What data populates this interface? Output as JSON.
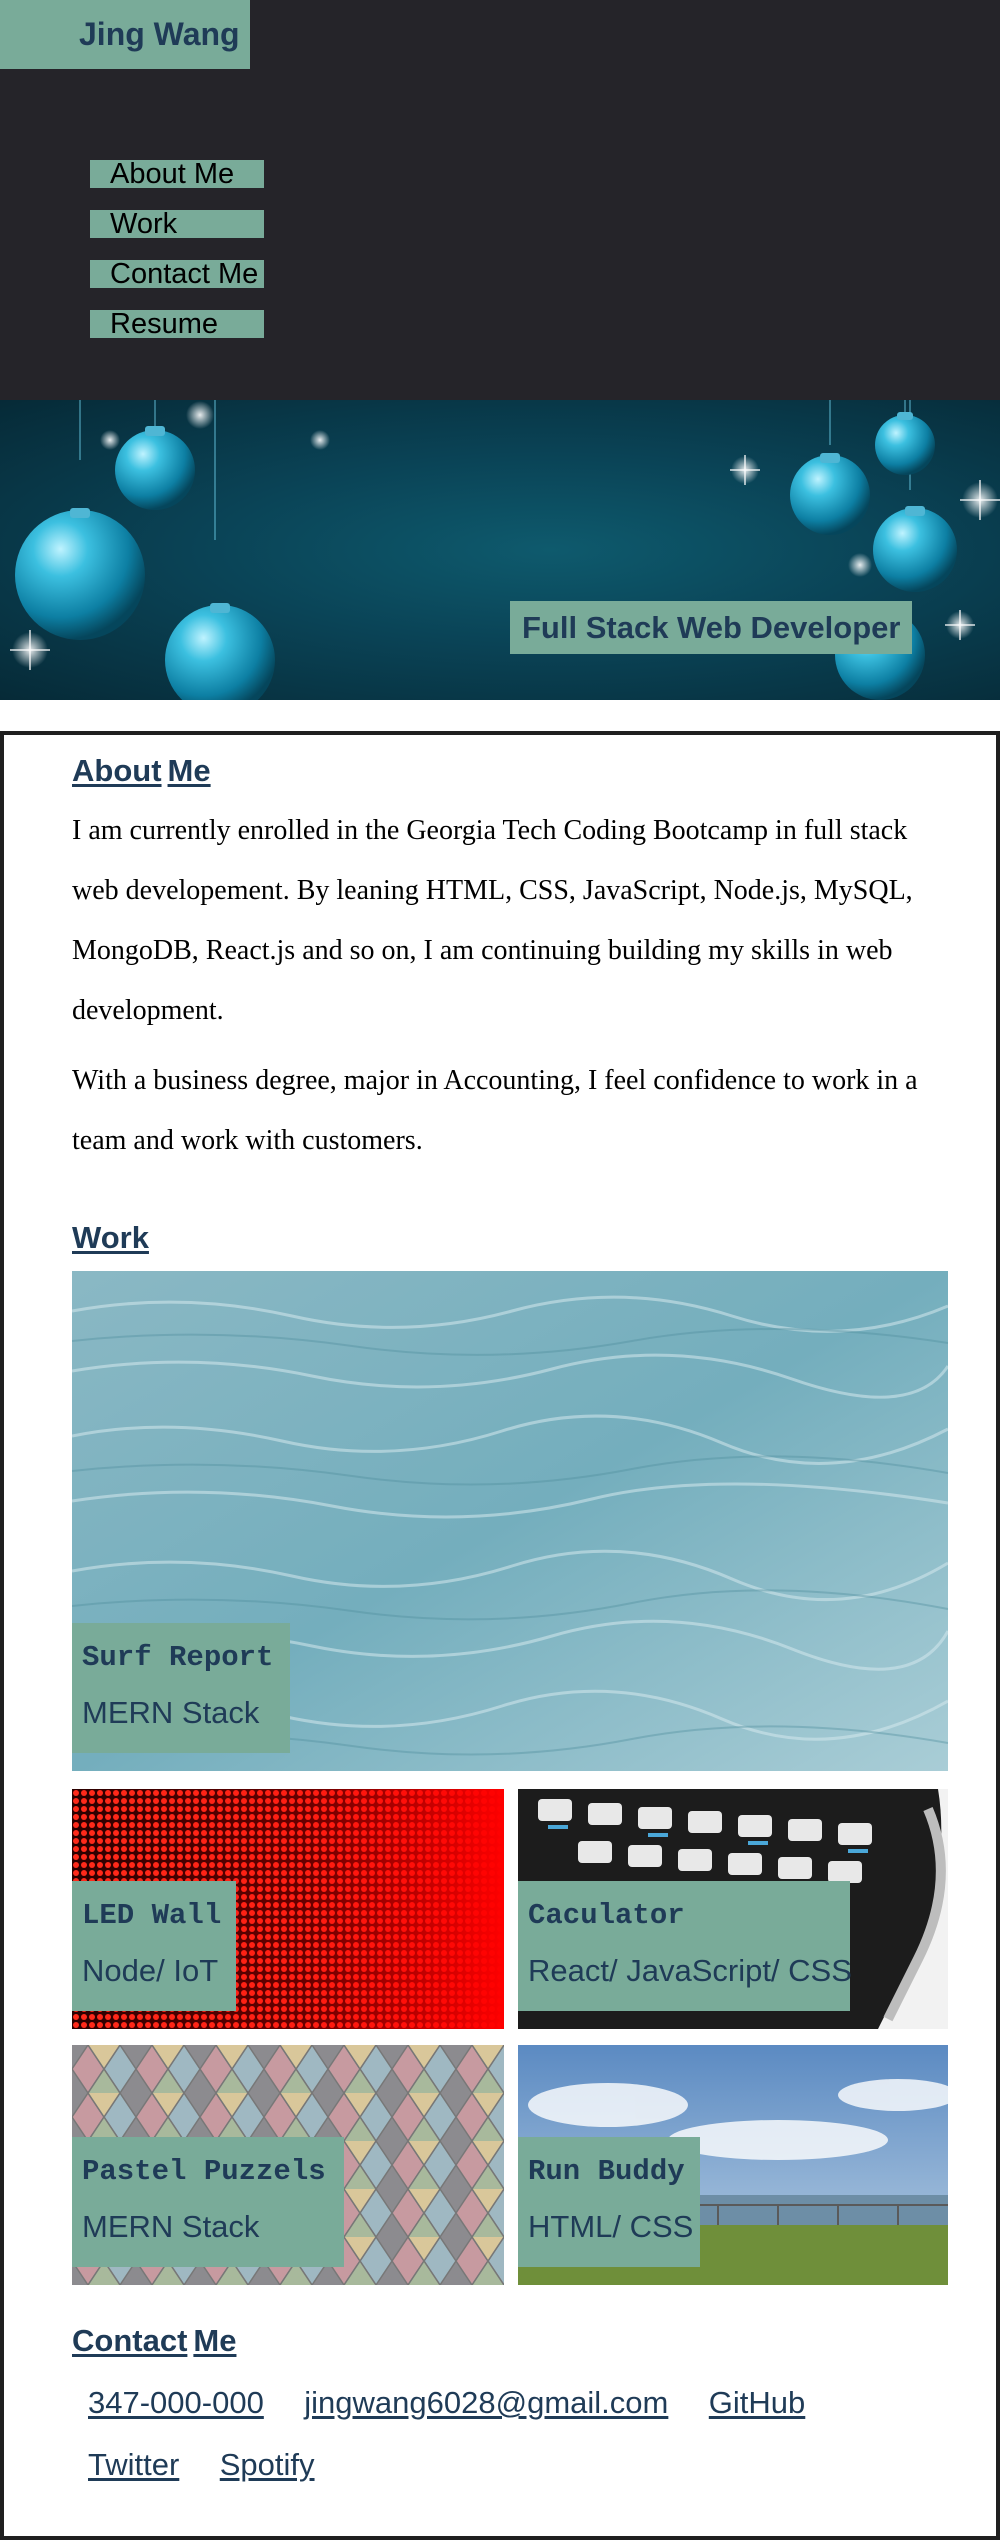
{
  "header": {
    "brand": "Jing Wang",
    "nav": [
      "About Me",
      "Work",
      "Contact Me",
      "Resume"
    ]
  },
  "hero": {
    "title": "Full Stack Web Developer"
  },
  "about": {
    "title_word1": "About",
    "title_word2": "Me",
    "paragraphs": [
      "I am currently enrolled in the Georgia Tech Coding Bootcamp in full stack web developement. By leaning HTML, CSS, JavaScript, Node.js, MySQL, MongoDB, React.js and so on, I am continuing building my skills in web development.",
      "With a business degree, major in Accounting, I feel confidence to work in a team and work with customers."
    ]
  },
  "work": {
    "title": "Work",
    "projects": [
      {
        "name": "Surf Report",
        "stack": "MERN Stack"
      },
      {
        "name": "LED Wall",
        "stack": "Node/ IoT"
      },
      {
        "name": "Caculator",
        "stack": "React/ JavaScript/ CSS"
      },
      {
        "name": "Pastel Puzzels",
        "stack": "MERN Stack"
      },
      {
        "name": "Run Buddy",
        "stack": "HTML/ CSS"
      }
    ]
  },
  "contact": {
    "title_word1": "Contact",
    "title_word2": "Me",
    "links": [
      "347-000-000",
      "jingwang6028@gmail.com",
      "GitHub",
      "Twitter",
      "Spotify"
    ]
  },
  "colors": {
    "accent": "#79ab99",
    "text_dark_blue": "#1f3b57",
    "header_bg": "#252429",
    "border": "#1f1f1f"
  }
}
